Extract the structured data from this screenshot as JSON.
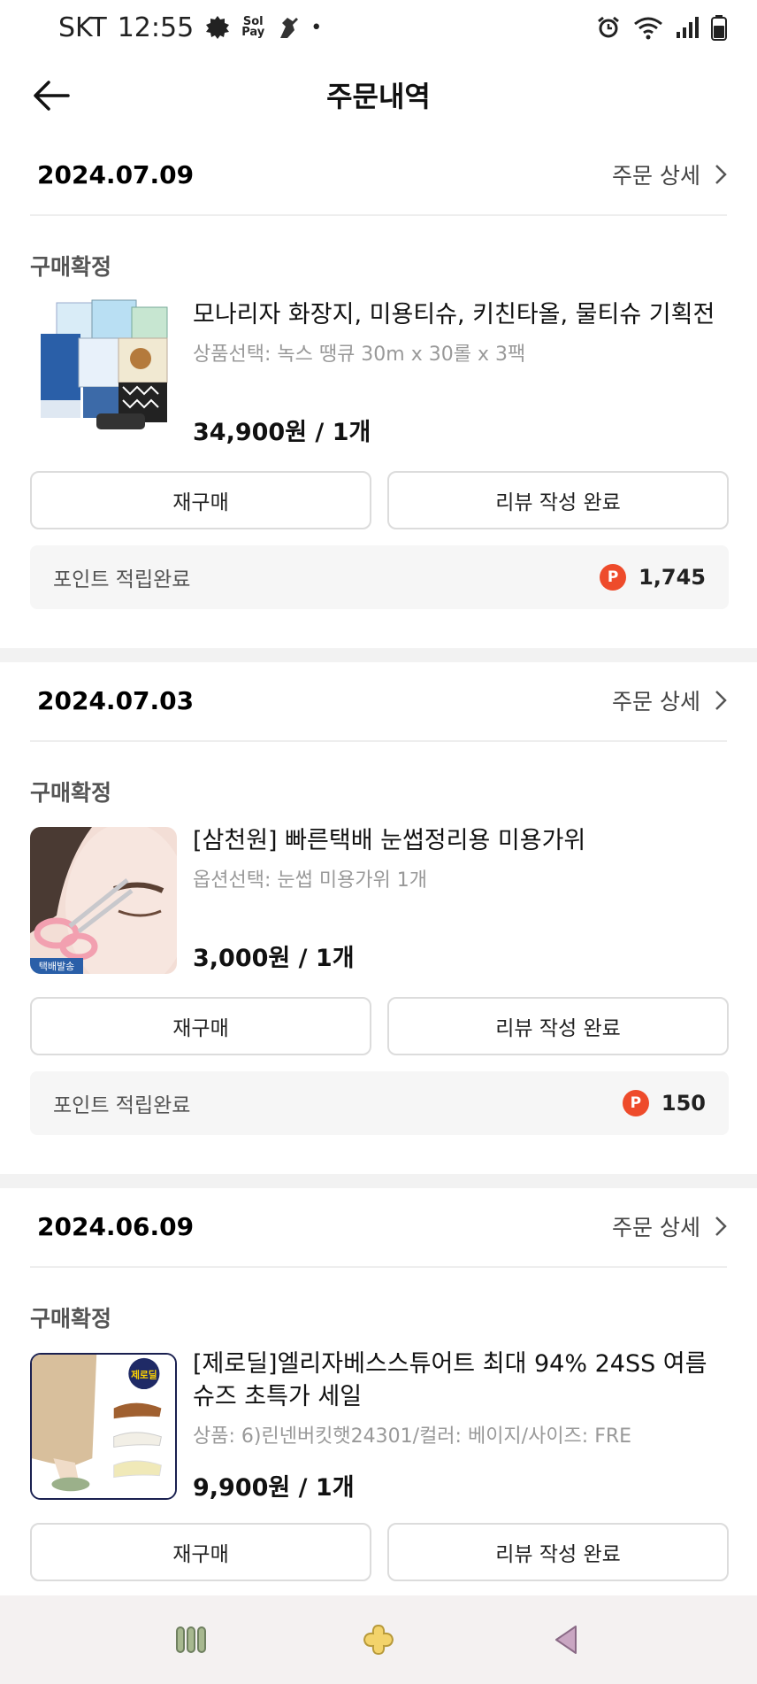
{
  "status_bar": {
    "carrier": "SKT",
    "time": "12:55",
    "pay_label_top": "Sol",
    "pay_label_bottom": "Pay",
    "dot": "•"
  },
  "header": {
    "title": "주문내역",
    "back_icon": "arrow-left-icon"
  },
  "orders": [
    {
      "date": "2024.07.09",
      "detail_label": "주문 상세",
      "status": "구매확정",
      "product_name": "모나리자 화장지, 미용티슈, 키친타올, 물티슈 기획전",
      "option": "상품선택: 녹스 땡큐 30m x 30롤 x 3팩",
      "price": "34,900원 / 1개",
      "rebuy_label": "재구매",
      "review_label": "리뷰 작성 완료",
      "points_label": "포인트 적립완료",
      "points_badge": "P",
      "points_value": "1,745"
    },
    {
      "date": "2024.07.03",
      "detail_label": "주문 상세",
      "status": "구매확정",
      "product_name": "[삼천원] 빠른택배 눈썹정리용 미용가위",
      "option": "옵션선택: 눈썹 미용가위 1개",
      "price": "3,000원 / 1개",
      "rebuy_label": "재구매",
      "review_label": "리뷰 작성 완료",
      "points_label": "포인트 적립완료",
      "points_badge": "P",
      "points_value": "150",
      "thumb_tag": "택배발송"
    },
    {
      "date": "2024.06.09",
      "detail_label": "주문 상세",
      "status": "구매확정",
      "product_name_line1": "[제로딜]엘리자베스스튜어트 최대 94% 24SS 여름",
      "product_name_line2": "슈즈 초특가 세일",
      "option": "상품: 6)린넨버킷햇24301/컬러: 베이지/사이즈: FRE",
      "price": "9,900원 / 1개",
      "rebuy_label": "재구매",
      "review_label": "리뷰 작성 완료",
      "thumb_badge": "제로딜"
    }
  ],
  "colors": {
    "points_badge": "#ee4b2b",
    "divider": "#f2f2f2",
    "navbar_bg": "#f4f1f1",
    "nav_icon": "#8ea27a"
  }
}
